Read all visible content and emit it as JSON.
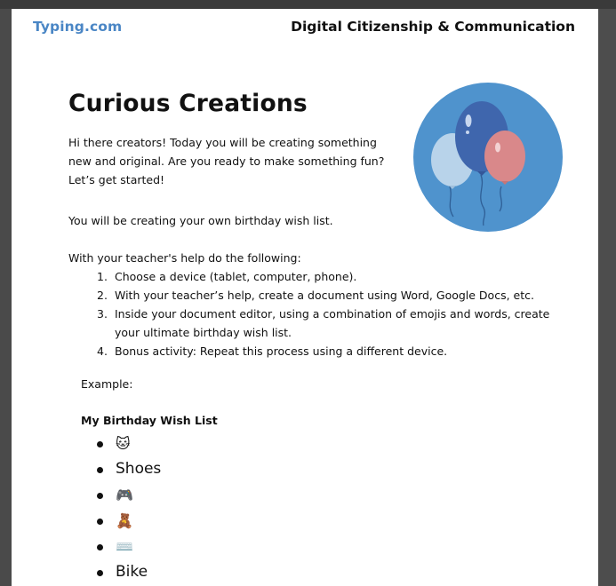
{
  "header": {
    "brand": "Typing.com",
    "section": "Digital Citizenship & Communication"
  },
  "lesson": {
    "title": "Curious Creations",
    "intro": "Hi there creators! Today you will be creating something new and original. Are you ready to make something fun? Let’s get started!",
    "wish_intro": "You will be creating your own birthday wish list.",
    "steps_intro": "With your teacher's help do the following:",
    "steps": [
      {
        "num": "1.",
        "text": "Choose a device (tablet, computer, phone)."
      },
      {
        "num": "2.",
        "text": "With your teacher’s help, create a document using Word, Google Docs, etc."
      },
      {
        "num": "3.",
        "text": "Inside your document editor, using a combination of emojis and words, create your ultimate birthday wish list."
      },
      {
        "num": "4.",
        "text": "Bonus activity: Repeat this process using a different device."
      }
    ],
    "example_label": "Example:",
    "wish_list_title": "My Birthday Wish List",
    "wish_list": [
      {
        "text": "🐱",
        "icon": "cat-emoji"
      },
      {
        "text": "Shoes",
        "icon": ""
      },
      {
        "text": "🎮",
        "icon": "game-controller-emoji"
      },
      {
        "text": "🧸",
        "icon": "teddy-bear-emoji"
      },
      {
        "text": "⌨️",
        "icon": "keyboard-emoji"
      },
      {
        "text": "Bike",
        "icon": ""
      }
    ]
  },
  "colors": {
    "brand_blue": "#4a86c5",
    "circle_blue": "#4f93cd",
    "balloon_dark_blue": "#3f66ad",
    "balloon_light_blue": "#b8d3ea",
    "balloon_pink": "#d9888a",
    "viewer_background": "#4a4a4a"
  }
}
